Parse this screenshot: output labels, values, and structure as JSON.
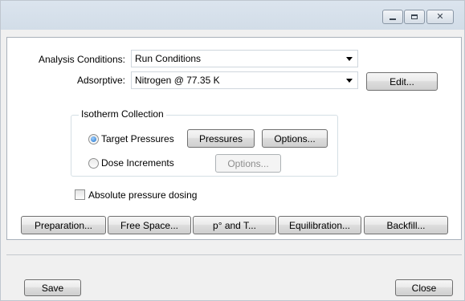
{
  "window": {
    "controls": {
      "minimize": "minimize-icon",
      "maximize": "maximize-icon",
      "close": "close-icon"
    }
  },
  "form": {
    "analysis_conditions": {
      "label": "Analysis Conditions:",
      "value": "Run Conditions"
    },
    "adsorptive": {
      "label": "Adsorptive:",
      "value": "Nitrogen @ 77.35 K"
    },
    "edit_button": "Edit..."
  },
  "isotherm": {
    "title": "Isotherm Collection",
    "target_pressures": {
      "label": "Target Pressures",
      "selected": true
    },
    "pressures_button": "Pressures",
    "target_options_button": "Options...",
    "dose_increments": {
      "label": "Dose Increments",
      "selected": false
    },
    "dose_options_button": "Options..."
  },
  "absolute_pressure": {
    "label": "Absolute pressure dosing",
    "checked": false
  },
  "bottom_buttons": {
    "preparation": "Preparation...",
    "free_space": "Free Space...",
    "p0_and_t": "p° and T...",
    "equilibration": "Equilibration...",
    "backfill": "Backfill..."
  },
  "footer": {
    "save": "Save",
    "close": "Close"
  }
}
